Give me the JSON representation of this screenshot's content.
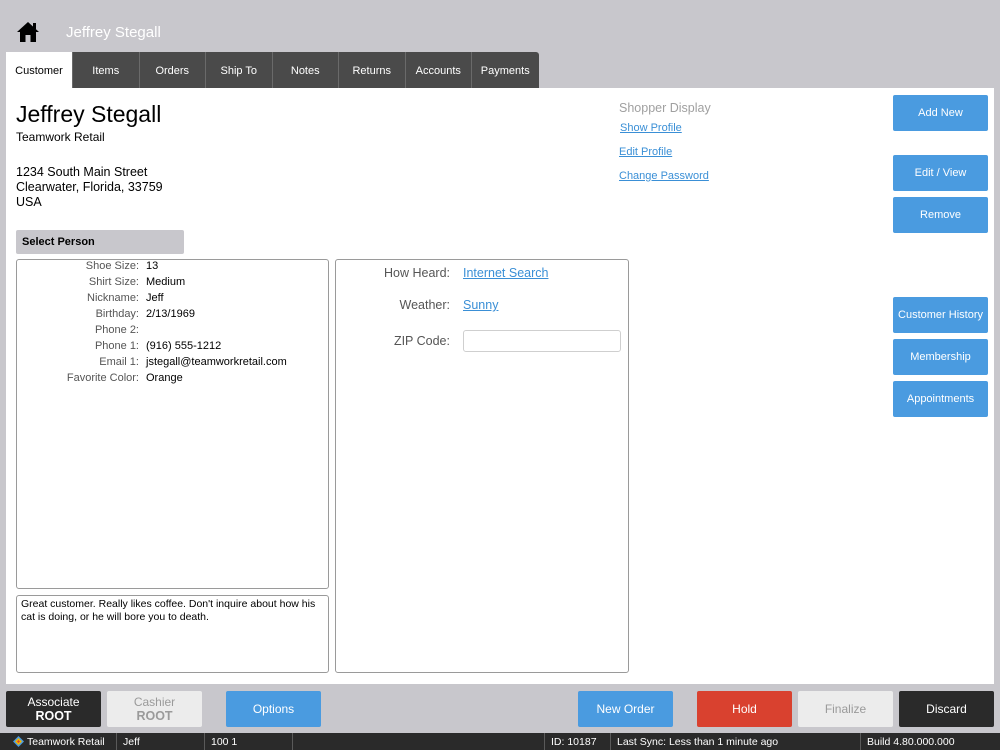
{
  "header": {
    "title": "Jeffrey Stegall"
  },
  "tabs": [
    "Customer",
    "Items",
    "Orders",
    "Ship To",
    "Notes",
    "Returns",
    "Accounts",
    "Payments"
  ],
  "customer": {
    "name": "Jeffrey Stegall",
    "company": "Teamwork Retail",
    "address_line1": "1234 South Main Street",
    "address_line2": "Clearwater, Florida, 33759",
    "address_line3": "USA",
    "select_person_label": "Select Person"
  },
  "details": [
    {
      "label": "Shoe Size:",
      "value": "13"
    },
    {
      "label": "Shirt Size:",
      "value": "Medium"
    },
    {
      "label": "Nickname:",
      "value": "Jeff"
    },
    {
      "label": "Birthday:",
      "value": "2/13/1969"
    },
    {
      "label": "Phone 2:",
      "value": ""
    },
    {
      "label": "Phone 1:",
      "value": "(916) 555-1212"
    },
    {
      "label": "Email 1:",
      "value": "jstegall@teamworkretail.com"
    },
    {
      "label": "Favorite Color:",
      "value": "Orange"
    }
  ],
  "notes": "Great customer.  Really likes coffee.  Don't inquire about how his cat is doing, or he will bore you to death.",
  "extra": {
    "how_heard_label": "How Heard:",
    "how_heard_value": "Internet Search",
    "weather_label": "Weather:",
    "weather_value": "Sunny",
    "zip_label": "ZIP Code:",
    "zip_value": ""
  },
  "profile": {
    "shopper_display": "Shopper Display",
    "show_profile": "Show Profile",
    "edit_profile": "Edit Profile",
    "change_password": "Change Password"
  },
  "side_buttons": {
    "add_new": "Add New",
    "edit_view": "Edit / View",
    "remove": "Remove",
    "customer_history": "Customer History",
    "membership": "Membership",
    "appointments": "Appointments"
  },
  "bottom": {
    "associate_label": "Associate",
    "associate_value": "ROOT",
    "cashier_label": "Cashier",
    "cashier_value": "ROOT",
    "options": "Options",
    "new_order": "New Order",
    "hold": "Hold",
    "finalize": "Finalize",
    "discard": "Discard"
  },
  "status": {
    "company": "Teamwork Retail",
    "user": "Jeff",
    "register": "100 1",
    "id": "ID: 10187",
    "last_sync": "Last Sync: Less than 1 minute ago",
    "build": "Build 4.80.000.000"
  },
  "colors": {
    "accent_blue": "#4a9be0",
    "hold_red": "#d9412f",
    "dark": "#2a2a2a",
    "background": "#c8c7cc"
  }
}
